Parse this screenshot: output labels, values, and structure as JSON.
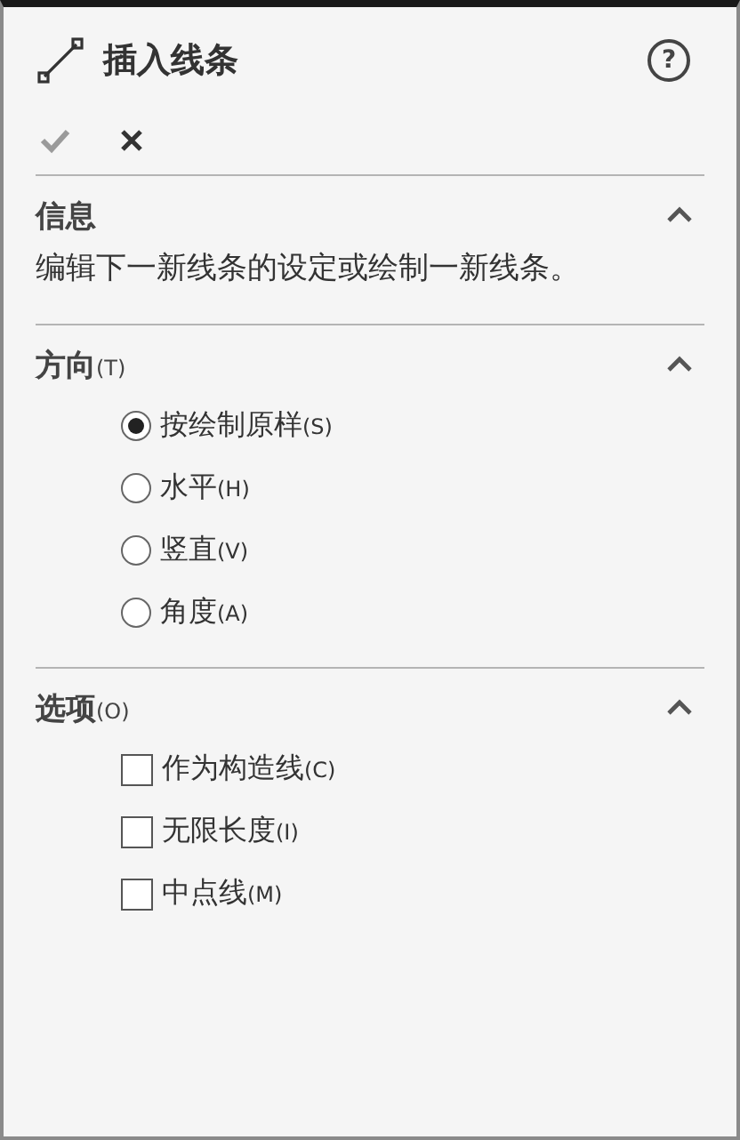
{
  "header": {
    "title": "插入线条",
    "help": "?"
  },
  "actions": [
    {
      "kind": "ok",
      "disabled": true
    },
    {
      "kind": "cancel",
      "disabled": false
    }
  ],
  "sections": [
    {
      "kind": "info",
      "title": "信息",
      "expanded": true,
      "text": "编辑下一新线条的设定或绘制一新线条。"
    },
    {
      "kind": "radios",
      "title": "方向",
      "shortcut": "(T)",
      "expanded": true,
      "items": [
        {
          "label": "按绘制原样",
          "shortcut": "(S)",
          "selected": true
        },
        {
          "label": "水平",
          "shortcut": "(H)",
          "selected": false
        },
        {
          "label": "竖直",
          "shortcut": "(V)",
          "selected": false
        },
        {
          "label": "角度",
          "shortcut": "(A)",
          "selected": false
        }
      ]
    },
    {
      "kind": "checks",
      "title": "选项",
      "shortcut": "(O)",
      "expanded": true,
      "items": [
        {
          "label": "作为构造线",
          "shortcut": "(C)",
          "checked": false
        },
        {
          "label": "无限长度",
          "shortcut": "(I)",
          "checked": false
        },
        {
          "label": "中点线",
          "shortcut": "(M)",
          "checked": false
        }
      ]
    }
  ]
}
